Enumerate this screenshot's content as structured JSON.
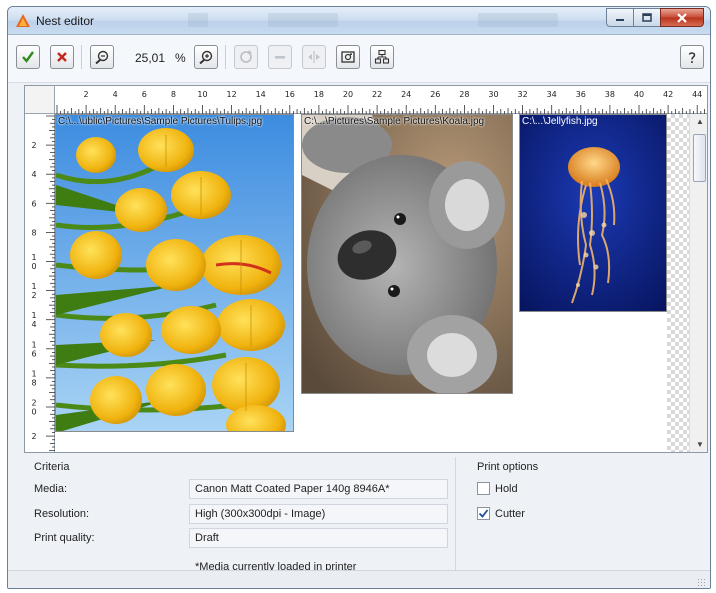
{
  "window": {
    "title": "Nest editor"
  },
  "toolbar": {
    "zoom_value": "25,01",
    "zoom_unit": "%",
    "buttons": [
      {
        "icon": "checkmark-icon",
        "enabled": true
      },
      {
        "icon": "delete-icon",
        "enabled": true
      },
      {
        "icon": "zoom-out-icon",
        "enabled": true
      },
      {
        "icon": "zoom-in-icon",
        "enabled": true
      },
      {
        "icon": "rotate-icon",
        "enabled": false
      },
      {
        "icon": "minus-icon",
        "enabled": false
      },
      {
        "icon": "mirror-icon",
        "enabled": false
      },
      {
        "icon": "fit-image-icon",
        "enabled": true
      },
      {
        "icon": "arrange-icon",
        "enabled": true
      },
      {
        "icon": "help-icon",
        "enabled": true
      }
    ]
  },
  "ruler": {
    "top_labels": [
      "2",
      "4",
      "6",
      "8",
      "10",
      "12",
      "14",
      "16",
      "18",
      "20",
      "22",
      "24",
      "26",
      "28",
      "30",
      "32",
      "34",
      "36",
      "38",
      "40",
      "42",
      "44"
    ],
    "left_labels": [
      "2",
      "4",
      "6",
      "8",
      "10",
      "12",
      "14",
      "16",
      "18",
      "20",
      "2"
    ]
  },
  "images": [
    {
      "caption": "C:\\...\\ublic\\Pictures\\Sample Pictures\\Tulips.jpg",
      "subject": "tulips"
    },
    {
      "caption": "C:\\...\\Pictures\\Sample Pictures\\Koala.jpg",
      "subject": "koala"
    },
    {
      "caption": "C:\\...\\Jellyfish.jpg",
      "subject": "jellyfish"
    }
  ],
  "criteria": {
    "title": "Criteria",
    "media_label": "Media:",
    "media_value": "Canon Matt Coated Paper 140g  8946A*",
    "resolution_label": "Resolution:",
    "resolution_value": "High (300x300dpi - Image)",
    "quality_label": "Print quality:",
    "quality_value": "Draft",
    "note": "*Media currently loaded in printer"
  },
  "print_options": {
    "title": "Print options",
    "hold_label": "Hold",
    "hold_checked": false,
    "cutter_label": "Cutter",
    "cutter_checked": true
  },
  "colors": {
    "sky": "#4f9be3",
    "tulip": "#f2c21a",
    "jellyfish_bg": "#0b1f7a",
    "koala_fur": "#8d8d8d"
  }
}
